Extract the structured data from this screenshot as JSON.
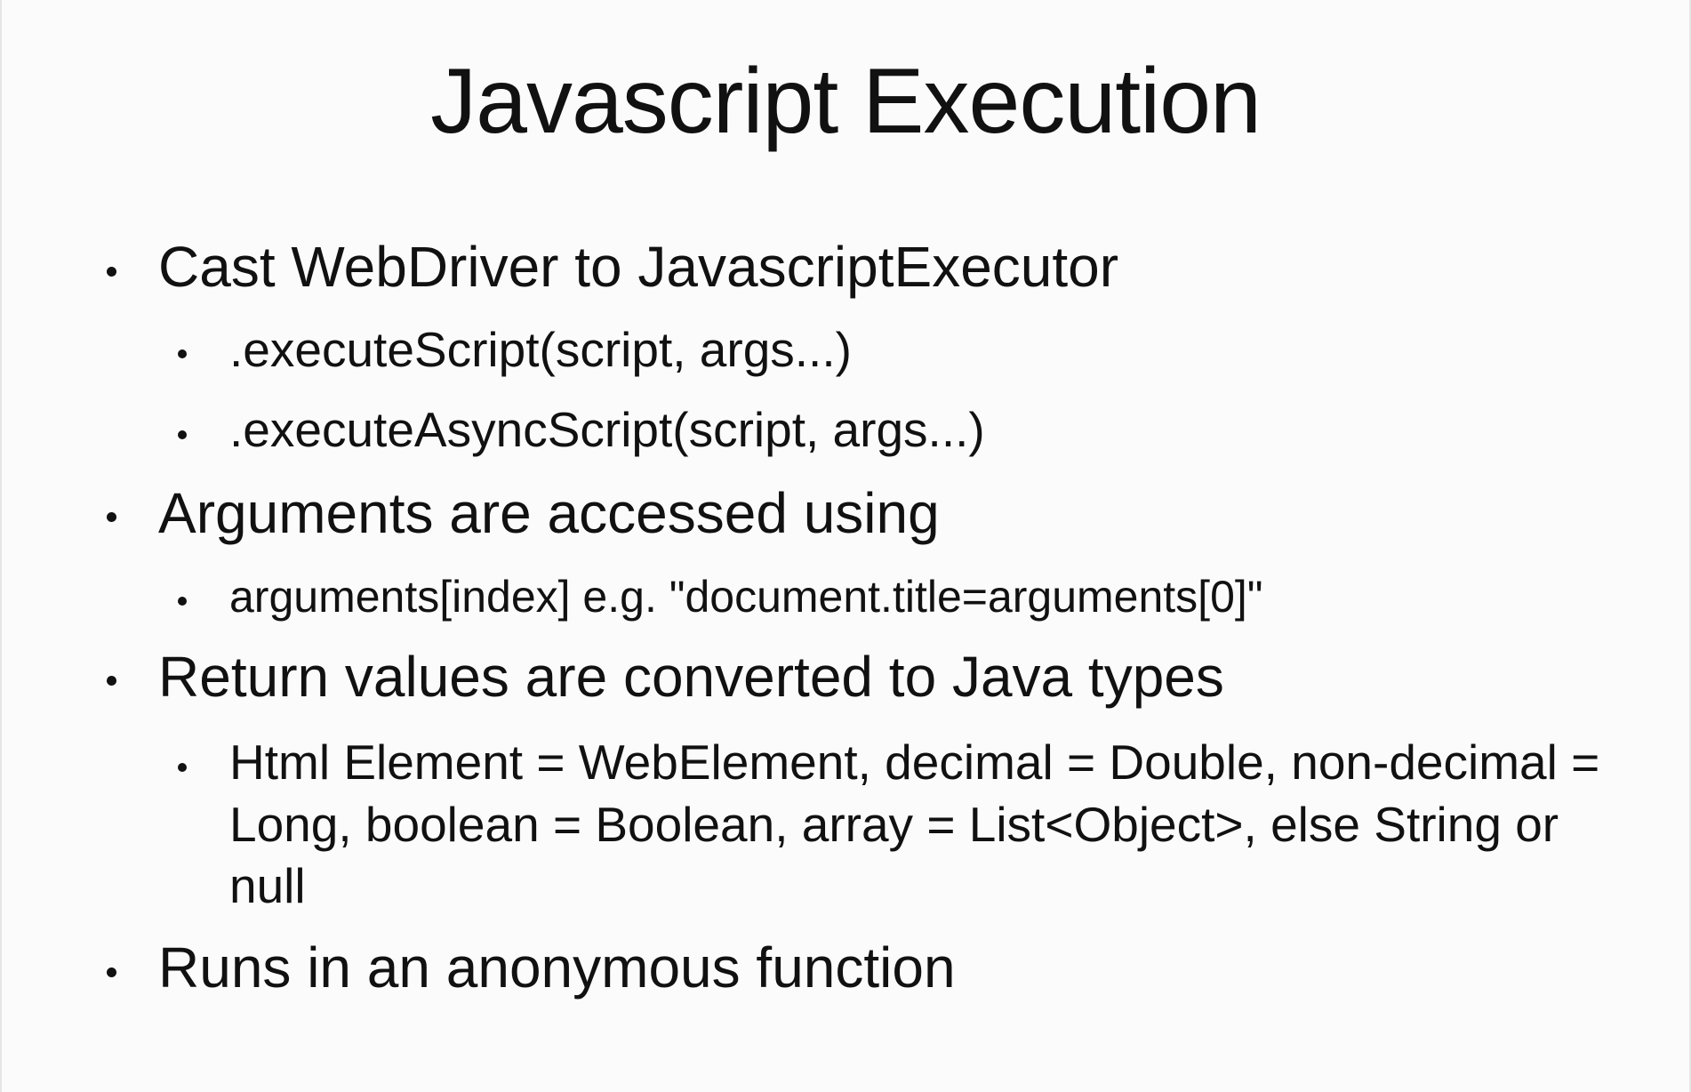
{
  "slide": {
    "title": "Javascript Execution",
    "bullets": [
      {
        "text": "Cast WebDriver to JavascriptExecutor",
        "sub": [
          ".executeScript(script, args...)",
          ".executeAsyncScript(script, args...)"
        ]
      },
      {
        "text": "Arguments are accessed using",
        "sub": [
          "arguments[index] e.g. \"document.title=arguments[0]\""
        ]
      },
      {
        "text": "Return values are converted to Java types",
        "sub": [
          "Html Element = WebElement, decimal = Double, non-decimal = Long, boolean = Boolean, array = List<Object>, else String or null"
        ]
      },
      {
        "text": "Runs in an anonymous function",
        "sub": []
      }
    ]
  }
}
